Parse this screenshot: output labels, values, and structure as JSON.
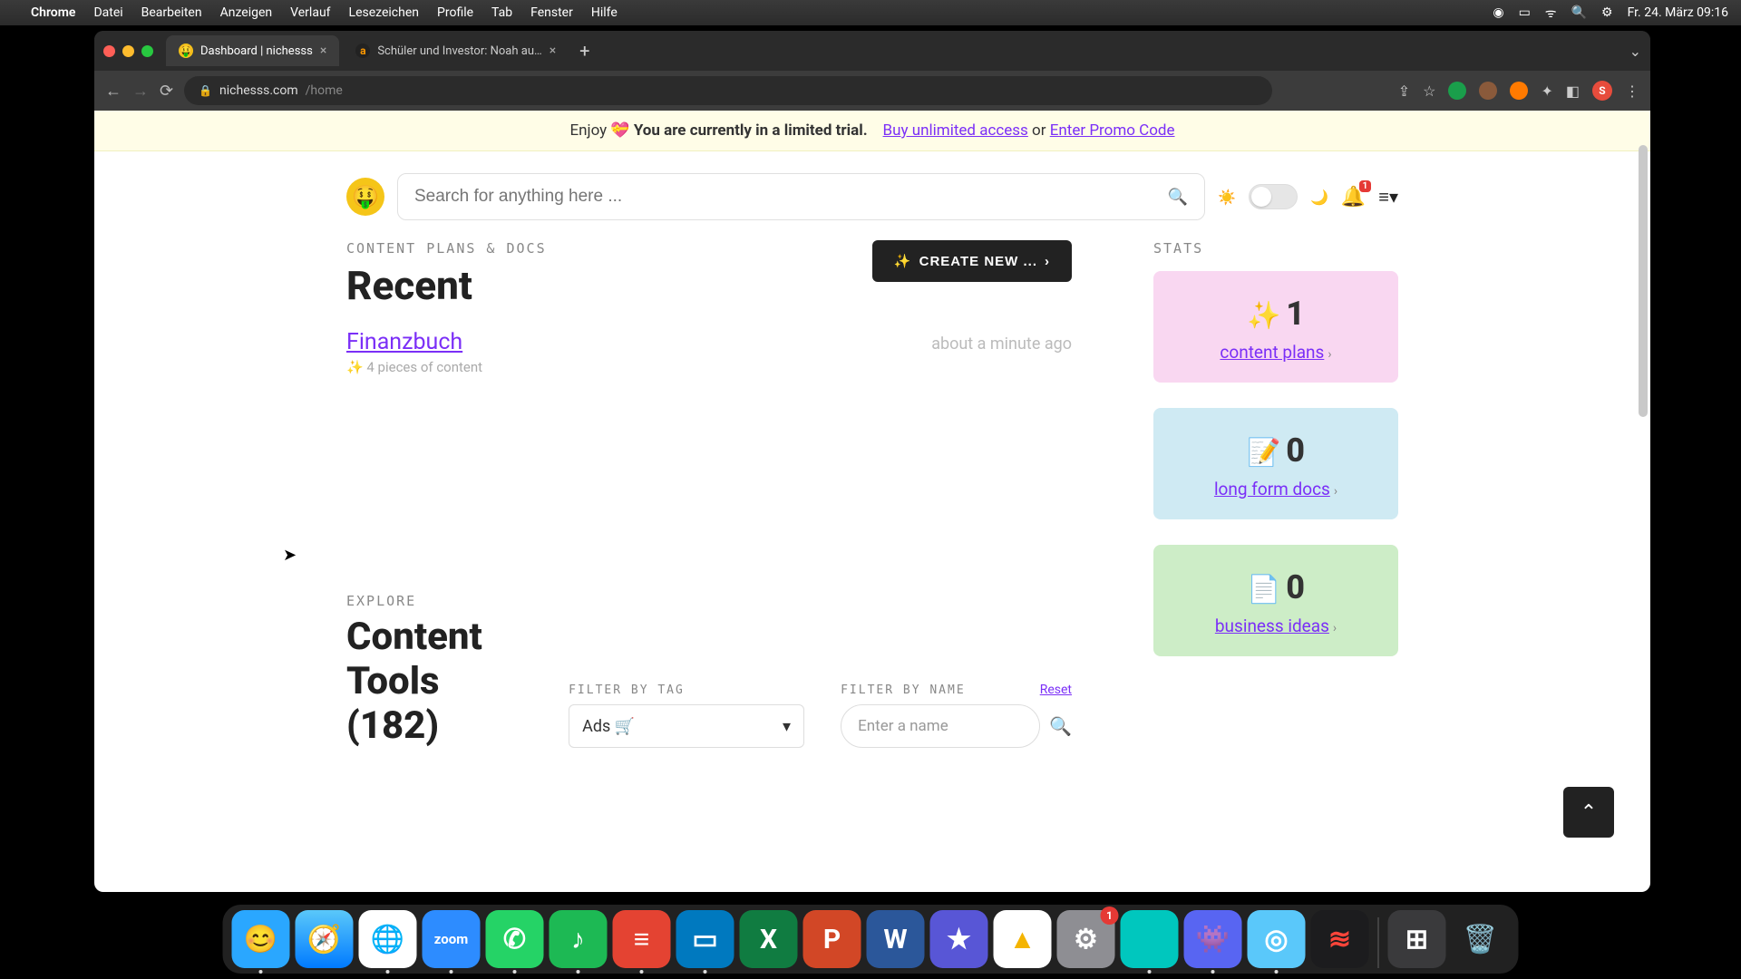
{
  "os": {
    "apple": "",
    "app": "Chrome",
    "menus": [
      "Datei",
      "Bearbeiten",
      "Anzeigen",
      "Verlauf",
      "Lesezeichen",
      "Profile",
      "Tab",
      "Fenster",
      "Hilfe"
    ],
    "clock": "Fr. 24. März 09:16"
  },
  "browser": {
    "tabs": [
      {
        "title": "Dashboard | nichesss",
        "active": true
      },
      {
        "title": "Schüler und Investor: Noah au…",
        "active": false
      }
    ],
    "url_host": "nichesss.com",
    "url_path": "/home",
    "avatar_letter": "S"
  },
  "banner": {
    "prefix": "Enjoy ",
    "emoji": "💝",
    "strong": " You are currently in a limited trial.",
    "link1": "Buy unlimited access",
    "or": " or ",
    "link2": "Enter Promo Code"
  },
  "header": {
    "search_placeholder": "Search for anything here ...",
    "bell_badge": "1"
  },
  "content": {
    "eyebrow": "CONTENT PLANS & DOCS",
    "title": "Recent",
    "create_label": "CREATE NEW ...",
    "items": [
      {
        "title": "Finanzbuch",
        "meta": "✨ 4 pieces of content",
        "ago": "about a minute ago"
      }
    ]
  },
  "stats": {
    "eyebrow": "STATS",
    "cards": [
      {
        "emoji": "✨",
        "value": "1",
        "label": "content plans"
      },
      {
        "emoji": "📝",
        "value": "0",
        "label": "long form docs"
      },
      {
        "emoji": "📄",
        "value": "0",
        "label": "business ideas"
      }
    ]
  },
  "explore": {
    "eyebrow": "EXPLORE",
    "title": "Content Tools (182)",
    "filter_tag_label": "FILTER BY TAG",
    "filter_tag_value": "Ads 🛒",
    "filter_name_label": "FILTER BY NAME",
    "filter_name_placeholder": "Enter a name",
    "reset": "Reset"
  },
  "dock": [
    {
      "name": "finder",
      "bg": "#2aa7ff",
      "glyph": "😊"
    },
    {
      "name": "safari",
      "bg": "linear-gradient(#5ac8fa,#007aff)",
      "glyph": "🧭"
    },
    {
      "name": "chrome",
      "bg": "#fff",
      "glyph": "🌐"
    },
    {
      "name": "zoom",
      "bg": "#2d8cff",
      "glyph": "zoom",
      "fs": "15"
    },
    {
      "name": "whatsapp",
      "bg": "#25d366",
      "glyph": "✆"
    },
    {
      "name": "spotify",
      "bg": "#1db954",
      "glyph": "♪"
    },
    {
      "name": "todoist",
      "bg": "#e44332",
      "glyph": "≡"
    },
    {
      "name": "trello",
      "bg": "#0079bf",
      "glyph": "▭"
    },
    {
      "name": "excel",
      "bg": "#107c41",
      "glyph": "X"
    },
    {
      "name": "powerpoint",
      "bg": "#d24726",
      "glyph": "P"
    },
    {
      "name": "word",
      "bg": "#2b579a",
      "glyph": "W"
    },
    {
      "name": "imovie",
      "bg": "#5856d6",
      "glyph": "★"
    },
    {
      "name": "drive",
      "bg": "#fff",
      "glyph": "▲"
    },
    {
      "name": "settings",
      "bg": "#8e8e93",
      "glyph": "⚙",
      "badge": "1"
    },
    {
      "name": "app-teal",
      "bg": "#00c7be",
      "glyph": ""
    },
    {
      "name": "discord",
      "bg": "#5865f2",
      "glyph": "👾"
    },
    {
      "name": "app-blue",
      "bg": "#5ac8fa",
      "glyph": "◎"
    },
    {
      "name": "voice",
      "bg": "#1c1c1e",
      "glyph": "≋"
    }
  ]
}
